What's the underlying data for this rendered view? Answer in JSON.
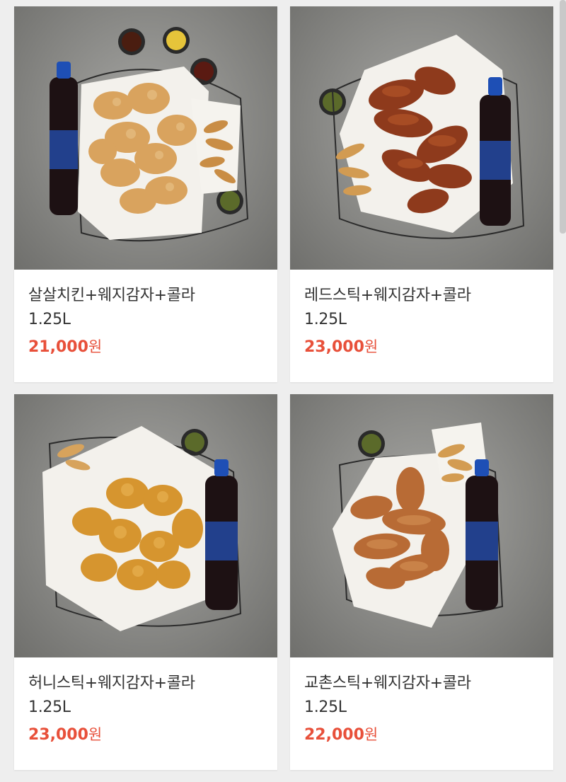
{
  "products": [
    {
      "name": "살살치킨+웨지감자+콜라",
      "size": "1.25L",
      "price": "21,000",
      "currency": "원",
      "image": "salsal-chicken-set-photo"
    },
    {
      "name": "레드스틱+웨지감자+콜라",
      "size": "1.25L",
      "price": "23,000",
      "currency": "원",
      "image": "red-stick-set-photo"
    },
    {
      "name": "허니스틱+웨지감자+콜라",
      "size": "1.25L",
      "price": "23,000",
      "currency": "원",
      "image": "honey-stick-set-photo"
    },
    {
      "name": "교촌스틱+웨지감자+콜라",
      "size": "1.25L",
      "price": "22,000",
      "currency": "원",
      "image": "kyochon-stick-set-photo"
    }
  ],
  "colors": {
    "price": "#e8503a",
    "text": "#333333",
    "background": "#eeeeee"
  }
}
